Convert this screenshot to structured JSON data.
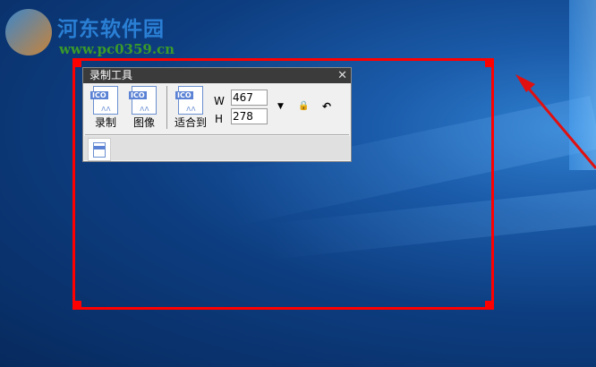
{
  "watermark": {
    "title": "河东软件园",
    "url": "www.pc0359.cn"
  },
  "toolbar": {
    "title": "录制工具",
    "close_icon": "close-icon",
    "buttons": [
      {
        "label": "录制",
        "icon": "ico-file-icon"
      },
      {
        "label": "图像",
        "icon": "ico-file-icon"
      },
      {
        "label": "适合到",
        "icon": "ico-file-icon"
      }
    ],
    "ico_text": "ICO",
    "width_label": "W",
    "width_value": "467",
    "height_label": "H",
    "height_value": "278",
    "dropdown_icon": "triangle-down-icon",
    "lock_icon": "lock-icon",
    "rotate_icon": "rotate-icon"
  },
  "colors": {
    "selection": "#ff0000",
    "titlebar": "#3b3b3b"
  }
}
